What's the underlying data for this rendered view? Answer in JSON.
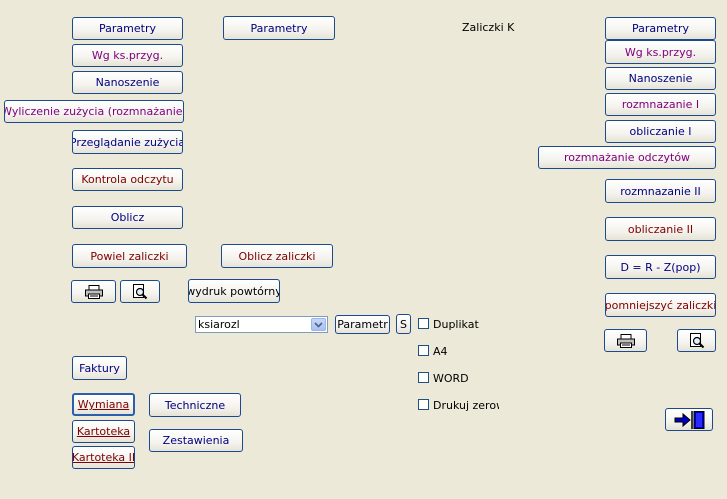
{
  "left": {
    "parametry": "Parametry",
    "wg_ks": "Wg ks.przyg.",
    "nanoszenie": "Nanoszenie",
    "wyliczenie": "Wyliczenie zużycia (rozmnażanie)",
    "przegladanie": "Przeglądanie zużycia",
    "kontrola": "Kontrola odczytu",
    "oblicz": "Oblicz",
    "powiel": "Powiel zaliczki",
    "faktury": "Faktury",
    "wymiana": "Wymiana",
    "kartoteka": "Kartoteka",
    "kartoteka2": "Kartoteka II"
  },
  "middle": {
    "parametry": "Parametry",
    "oblicz_zaliczki": "Oblicz zaliczki",
    "wydruk": "wydruk powtórny",
    "techniczne": "Techniczne",
    "zestawienia": "Zestawienia",
    "combo_value": "ksiarozl",
    "parametr_btn": "Parametr",
    "s_btn": "S",
    "checkboxes": [
      "Duplikat",
      "A4",
      "WORD",
      "Drukuj zerowe"
    ]
  },
  "title": "Zaliczki K",
  "right": {
    "parametry": "Parametry",
    "wg_ks": "Wg ks.przyg.",
    "nanoszenie": "Nanoszenie",
    "rozmnazanie1": "rozmnazanie I",
    "obliczanie1": "obliczanie I",
    "rozmnazanie_odczytow": "rozmnażanie odczytów",
    "rozmnazanie2": "rozmnazanie II",
    "obliczanie2": "obliczanie II",
    "d_formula": "D = R - Z(pop)",
    "pomniejszyc": "pomniejszyć zaliczki"
  },
  "icons": {
    "print": "printer-icon",
    "preview": "print-preview-icon",
    "exit": "exit-door-icon"
  },
  "colors": {
    "background": "#ece9d8",
    "navy_text": "#00007f",
    "purple_text": "#800080",
    "maroon_text": "#7f0000",
    "button_border": "#1c4a8c"
  }
}
